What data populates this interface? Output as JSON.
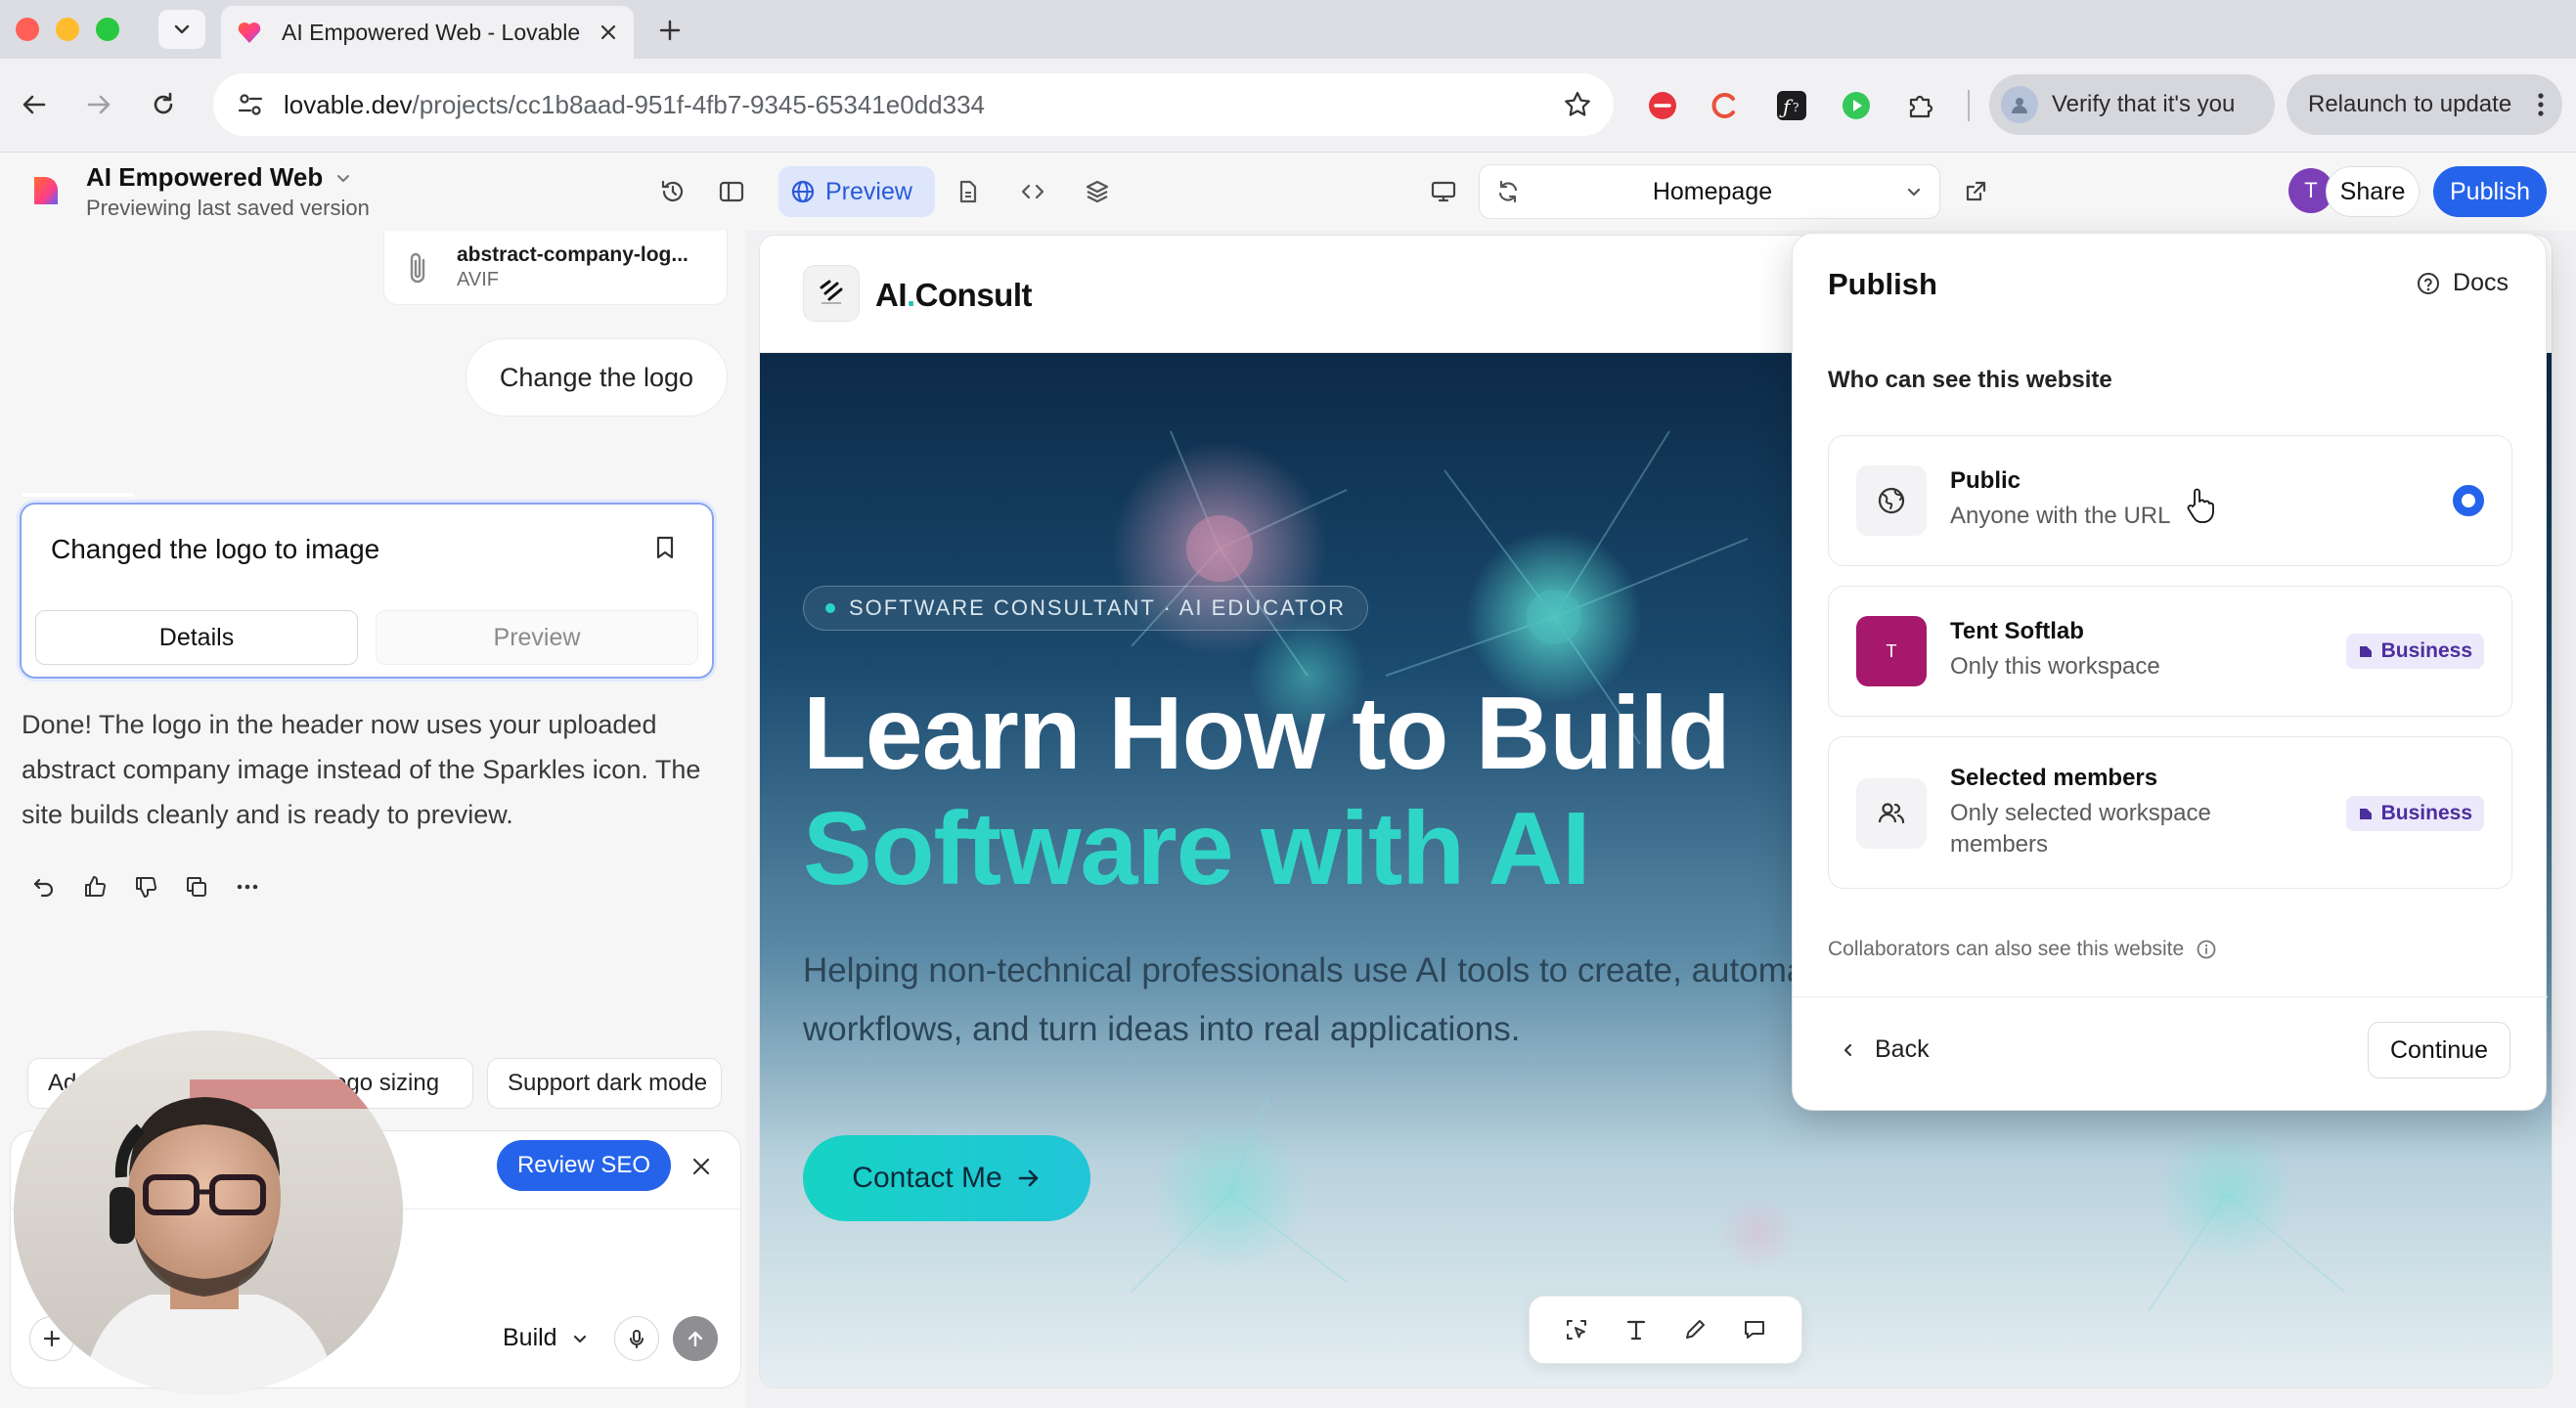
{
  "browser": {
    "tab_title": "AI Empowered Web - Lovable",
    "url_host": "lovable.dev",
    "url_path": "/projects/cc1b8aad-951f-4fb7-9345-65341e0dd334",
    "verify_label": "Verify that it's you",
    "relaunch_label": "Relaunch to update"
  },
  "header": {
    "project_title": "AI Empowered Web",
    "project_subtitle": "Previewing last saved version",
    "preview_label": "Preview",
    "page_selector": "Homepage",
    "avatar_initial": "T",
    "share_label": "Share",
    "publish_label": "Publish"
  },
  "chat": {
    "attachment": {
      "name": "abstract-company-log...",
      "type": "AVIF"
    },
    "user_message": "Change the logo",
    "version_card": {
      "title": "Changed the logo to image",
      "details_label": "Details",
      "preview_label": "Preview"
    },
    "reply": "Done! The logo in the header now uses your uploaded abstract company image instead of the Sparkles icon. The site builds cleanly and is ready to preview.",
    "suggestions": [
      "Add",
      "ogo sizing",
      "Support dark mode"
    ],
    "review_seo_label": "Review SEO",
    "mode_label": "Build"
  },
  "site": {
    "brand_prefix": "AI",
    "brand_dot": ".",
    "brand_suffix": "Consult",
    "badge": "SOFTWARE CONSULTANT · AI EDUCATOR",
    "headline_line1": "Learn How to Build",
    "headline_line2": "Software with AI",
    "paragraph": "Helping non-technical professionals use AI tools to create, automate workflows, and turn ideas into real applications.",
    "cta_label": "Contact Me"
  },
  "publish_popover": {
    "title": "Publish",
    "docs_label": "Docs",
    "subtitle": "Who can see this website",
    "options": [
      {
        "title": "Public",
        "description": "Anyone with the URL",
        "selected": true
      },
      {
        "title": "Tent Softlab",
        "description": "Only this workspace",
        "avatar_initial": "T",
        "badge": "Business"
      },
      {
        "title": "Selected members",
        "description": "Only selected workspace members",
        "badge": "Business"
      }
    ],
    "note": "Collaborators can also see this website",
    "back_label": "Back",
    "continue_label": "Continue"
  },
  "colors": {
    "accent_blue": "#2563eb",
    "hero_teal": "#2fd6c7",
    "business_badge_bg": "#ece9fb",
    "tent_avatar": "#a6186b"
  }
}
